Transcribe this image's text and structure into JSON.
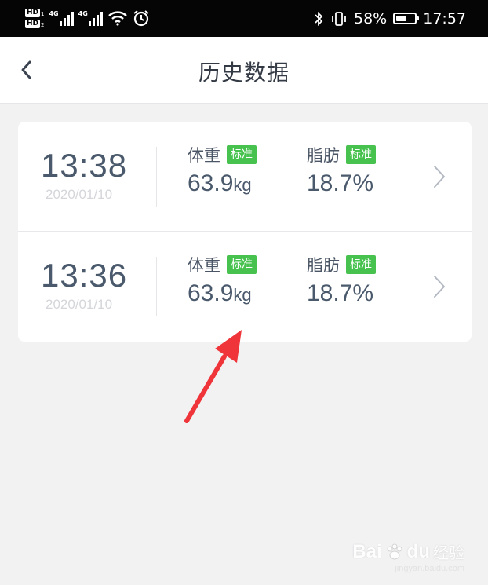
{
  "status_bar": {
    "hd1": "HD",
    "hd1_sub": "1",
    "hd2": "HD",
    "hd2_sub": "2",
    "net1": "4G",
    "net2": "4G",
    "battery_percent_text": "58%",
    "battery_level": 0.58,
    "time": "17:57"
  },
  "nav": {
    "title": "历史数据",
    "back_icon": "chevron-left-icon"
  },
  "records": [
    {
      "time": "13:38",
      "date": "2020/01/10",
      "weight_label": "体重",
      "weight_badge": "标准",
      "weight_value": "63.9",
      "weight_unit": "kg",
      "fat_label": "脂肪",
      "fat_badge": "标准",
      "fat_value": "18.7",
      "fat_unit": "%"
    },
    {
      "time": "13:36",
      "date": "2020/01/10",
      "weight_label": "体重",
      "weight_badge": "标准",
      "weight_value": "63.9",
      "weight_unit": "kg",
      "fat_label": "脂肪",
      "fat_badge": "标准",
      "fat_value": "18.7",
      "fat_unit": "%"
    }
  ],
  "colors": {
    "badge_green": "#47c24f",
    "annotation_red": "#f0353a",
    "text_dark": "#4a5a6c"
  },
  "watermark": {
    "logo": "Bai",
    "logo_end": "du",
    "cn": "经验",
    "url": "jingyan.baidu.com"
  }
}
